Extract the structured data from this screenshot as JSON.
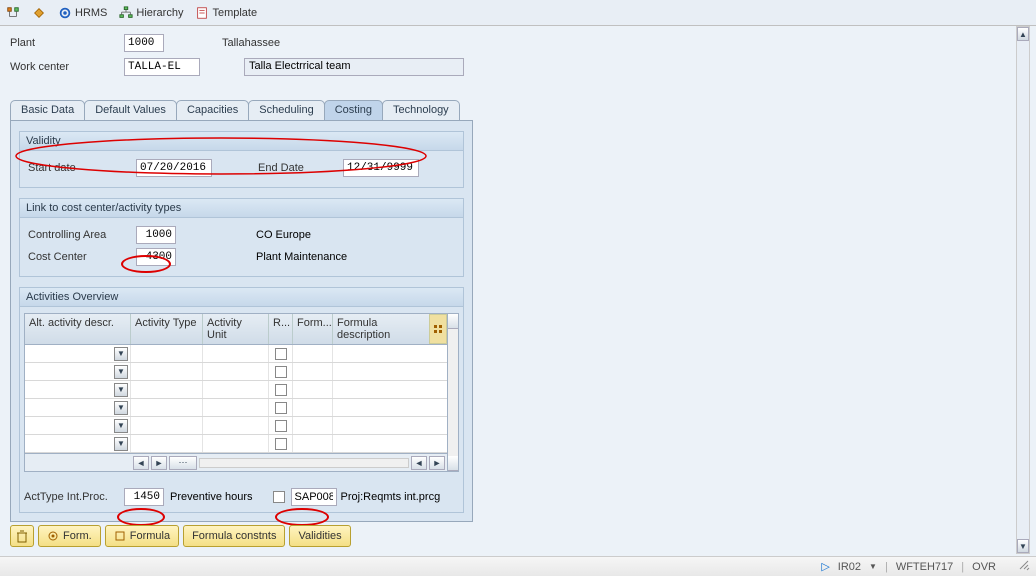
{
  "toolbar": {
    "hrms": "HRMS",
    "hierarchy": "Hierarchy",
    "template": "Template"
  },
  "header": {
    "plant_label": "Plant",
    "plant_value": "1000",
    "plant_text": "Tallahassee",
    "wc_label": "Work center",
    "wc_value": "TALLA-EL",
    "wc_text": "Talla Electrrical team"
  },
  "tabs": [
    "Basic Data",
    "Default Values",
    "Capacities",
    "Scheduling",
    "Costing",
    "Technology"
  ],
  "active_tab": 4,
  "validity": {
    "title": "Validity",
    "start_label": "Start date",
    "start_value": "07/20/2016",
    "end_label": "End Date",
    "end_value": "12/31/9999"
  },
  "costlink": {
    "title": "Link to cost center/activity types",
    "area_label": "Controlling Area",
    "area_value": "1000",
    "area_text": "CO Europe",
    "cc_label": "Cost Center",
    "cc_value": "4300",
    "cc_text": "Plant Maintenance"
  },
  "activities": {
    "title": "Activities Overview",
    "columns": [
      "Alt. activity descr.",
      "Activity Type",
      "Activity Unit",
      "R...",
      "Form...",
      "Formula description"
    ]
  },
  "intproc": {
    "label": "ActType Int.Proc.",
    "value": "1450",
    "text": "Preventive hours",
    "code": "SAP008",
    "desc": "Proj:Reqmts int.prcg"
  },
  "buttons": {
    "form": "Form.",
    "formula": "Formula",
    "constants": "Formula constnts",
    "validities": "Validities"
  },
  "status": {
    "tcode": "IR02",
    "host": "WFTEH717",
    "mode": "OVR"
  }
}
